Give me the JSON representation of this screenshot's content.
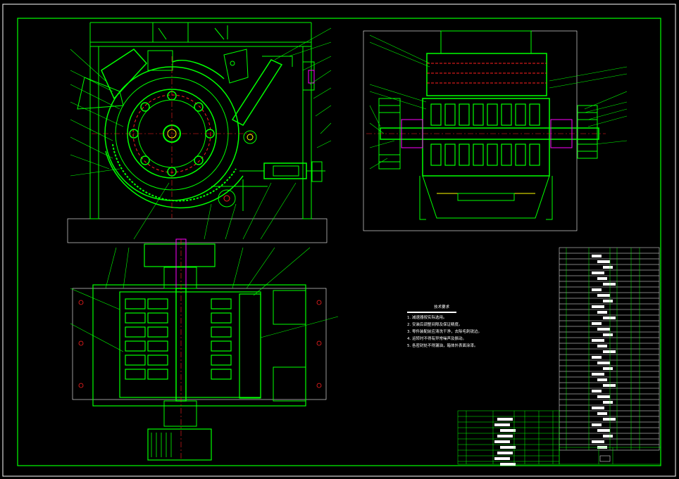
{
  "drawing": {
    "title": "CAD drawing — hammer crusher assembly",
    "colors": {
      "background": "#000000",
      "frame": "#00ff00",
      "line": "#00ff00",
      "hidden": "#ffffff",
      "center": "#ff2020",
      "accent": "#ffff00",
      "magenta": "#ff00ff",
      "cyan": "#00ffff"
    }
  },
  "views": {
    "front": {
      "name": "front-section-view"
    },
    "side": {
      "name": "side-section-view"
    },
    "top": {
      "name": "top-section-view"
    }
  },
  "technical_requirements": {
    "heading": "技术要求",
    "lines": [
      "1. 减速器按实际选用。",
      "2. 安装后调整间隙及保证精度。",
      "3. 零件装配前应清洗干净，去除毛刺锐边。",
      "4. 运转时不得有异常噪声及振动。",
      "5. 各密封处不得漏油，箱体外表面涂漆。"
    ]
  },
  "parts_list": {
    "name": "parts-list-table"
  },
  "title_block": {
    "name": "title-block"
  }
}
